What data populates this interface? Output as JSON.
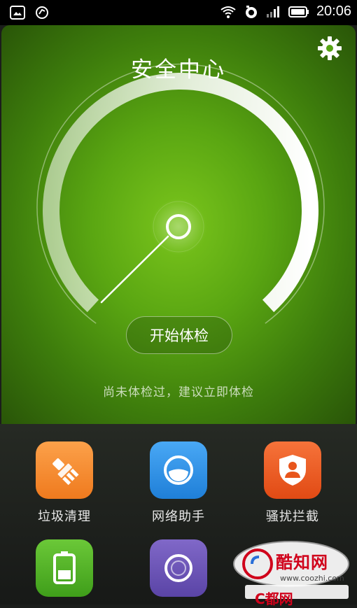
{
  "status_bar": {
    "time": "20:06",
    "left_icons": [
      "image-icon",
      "sync-icon"
    ],
    "right_icons": [
      "wifi-icon",
      "alarm-icon",
      "signal-icon",
      "battery-icon"
    ]
  },
  "header": {
    "title": "安全中心",
    "settings_icon": "gear-icon"
  },
  "gauge": {
    "accent": "#ffffff",
    "bg_gradient": [
      "#7ac51c",
      "#295508"
    ]
  },
  "scan": {
    "button_label": "开始体检",
    "hint": "尚未体检过，建议立即体检"
  },
  "tiles": [
    {
      "label": "垃圾清理",
      "icon": "broom-icon",
      "color": "#f3872a"
    },
    {
      "label": "网络助手",
      "icon": "network-icon",
      "color": "#2a8fe8"
    },
    {
      "label": "骚扰拦截",
      "icon": "shield-user-icon",
      "color": "#ee5a22"
    },
    {
      "label": "",
      "icon": "battery-icon",
      "color": "#54b424"
    },
    {
      "label": "",
      "icon": "ring-icon",
      "color": "#6e55b8"
    }
  ],
  "watermark": {
    "line1": "酷知网",
    "line2": "www.coozhi.com",
    "line3": "C都网"
  }
}
